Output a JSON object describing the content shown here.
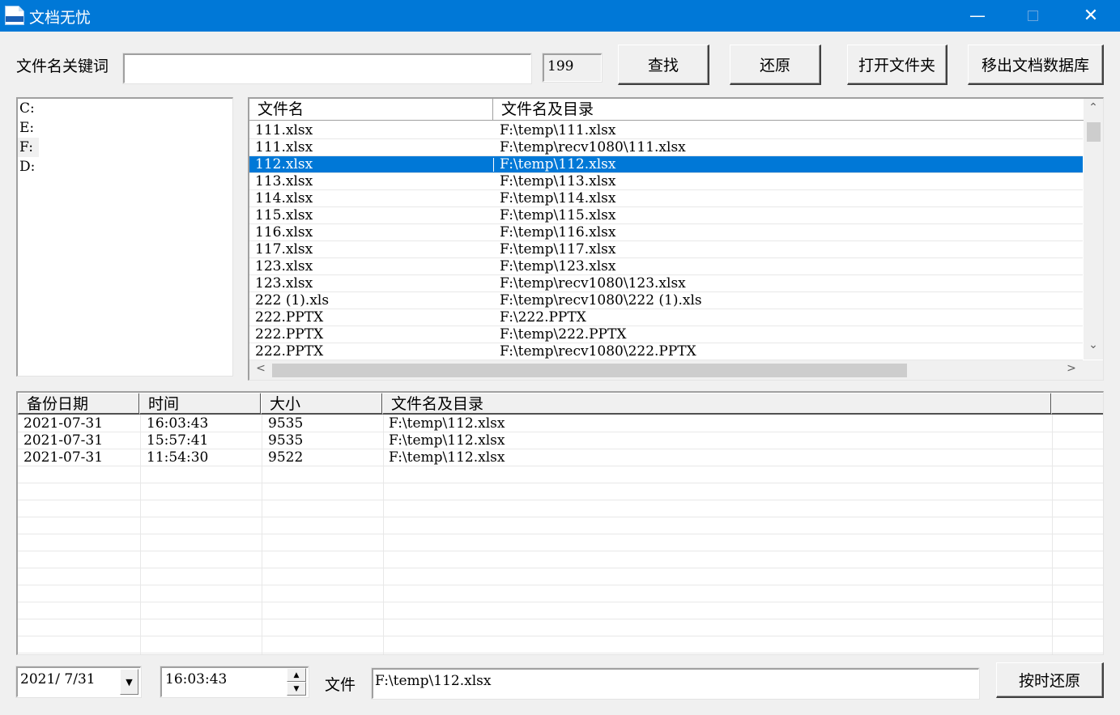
{
  "window": {
    "title": "文档无忧",
    "minimize_symbol": "—",
    "close_symbol": "✕"
  },
  "search": {
    "label": "文件名关键词",
    "keyword_value": "",
    "count": "199",
    "find_label": "查找",
    "restore_label": "还原",
    "open_folder_label": "打开文件夹",
    "remove_label": "移出文档数据库"
  },
  "drives": [
    "C:",
    "E:",
    "F:",
    "D:"
  ],
  "file_list": {
    "headers": [
      "文件名",
      "文件名及目录"
    ],
    "rows": [
      {
        "name": "111.xlsx",
        "path": "F:\\temp\\111.xlsx"
      },
      {
        "name": "111.xlsx",
        "path": "F:\\temp\\recv1080\\111.xlsx"
      },
      {
        "name": "112.xlsx",
        "path": "F:\\temp\\112.xlsx"
      },
      {
        "name": "113.xlsx",
        "path": "F:\\temp\\113.xlsx"
      },
      {
        "name": "114.xlsx",
        "path": "F:\\temp\\114.xlsx"
      },
      {
        "name": "115.xlsx",
        "path": "F:\\temp\\115.xlsx"
      },
      {
        "name": "116.xlsx",
        "path": "F:\\temp\\116.xlsx"
      },
      {
        "name": "117.xlsx",
        "path": "F:\\temp\\117.xlsx"
      },
      {
        "name": "123.xlsx",
        "path": "F:\\temp\\123.xlsx"
      },
      {
        "name": "123.xlsx",
        "path": "F:\\temp\\recv1080\\123.xlsx"
      },
      {
        "name": "222 (1).xls",
        "path": "F:\\temp\\recv1080\\222 (1).xls"
      },
      {
        "name": "222.PPTX",
        "path": "F:\\222.PPTX"
      },
      {
        "name": "222.PPTX",
        "path": "F:\\temp\\222.PPTX"
      },
      {
        "name": "222.PPTX",
        "path": "F:\\temp\\recv1080\\222.PPTX"
      }
    ],
    "selected_row": 2
  },
  "scroll": {
    "up": "⌃",
    "down": "⌄",
    "left": "<",
    "right": ">"
  },
  "backups": {
    "headers": [
      "备份日期",
      "时间",
      "大小",
      "文件名及目录"
    ],
    "rows": [
      {
        "date": "2021-07-31",
        "time": "16:03:43",
        "size": "9535",
        "path": "F:\\temp\\112.xlsx"
      },
      {
        "date": "2021-07-31",
        "time": "15:57:41",
        "size": "9535",
        "path": "F:\\temp\\112.xlsx"
      },
      {
        "date": "2021-07-31",
        "time": "11:54:30",
        "size": "9522",
        "path": "F:\\temp\\112.xlsx"
      }
    ]
  },
  "bottom": {
    "date_value": "2021/ 7/31",
    "time_value": "16:03:43",
    "file_label": "文件",
    "file_value": "F:\\temp\\112.xlsx",
    "restore_by_time_label": "按时还原",
    "dropdown_symbol": "▼",
    "spin_up": "▲",
    "spin_down": "▼"
  }
}
